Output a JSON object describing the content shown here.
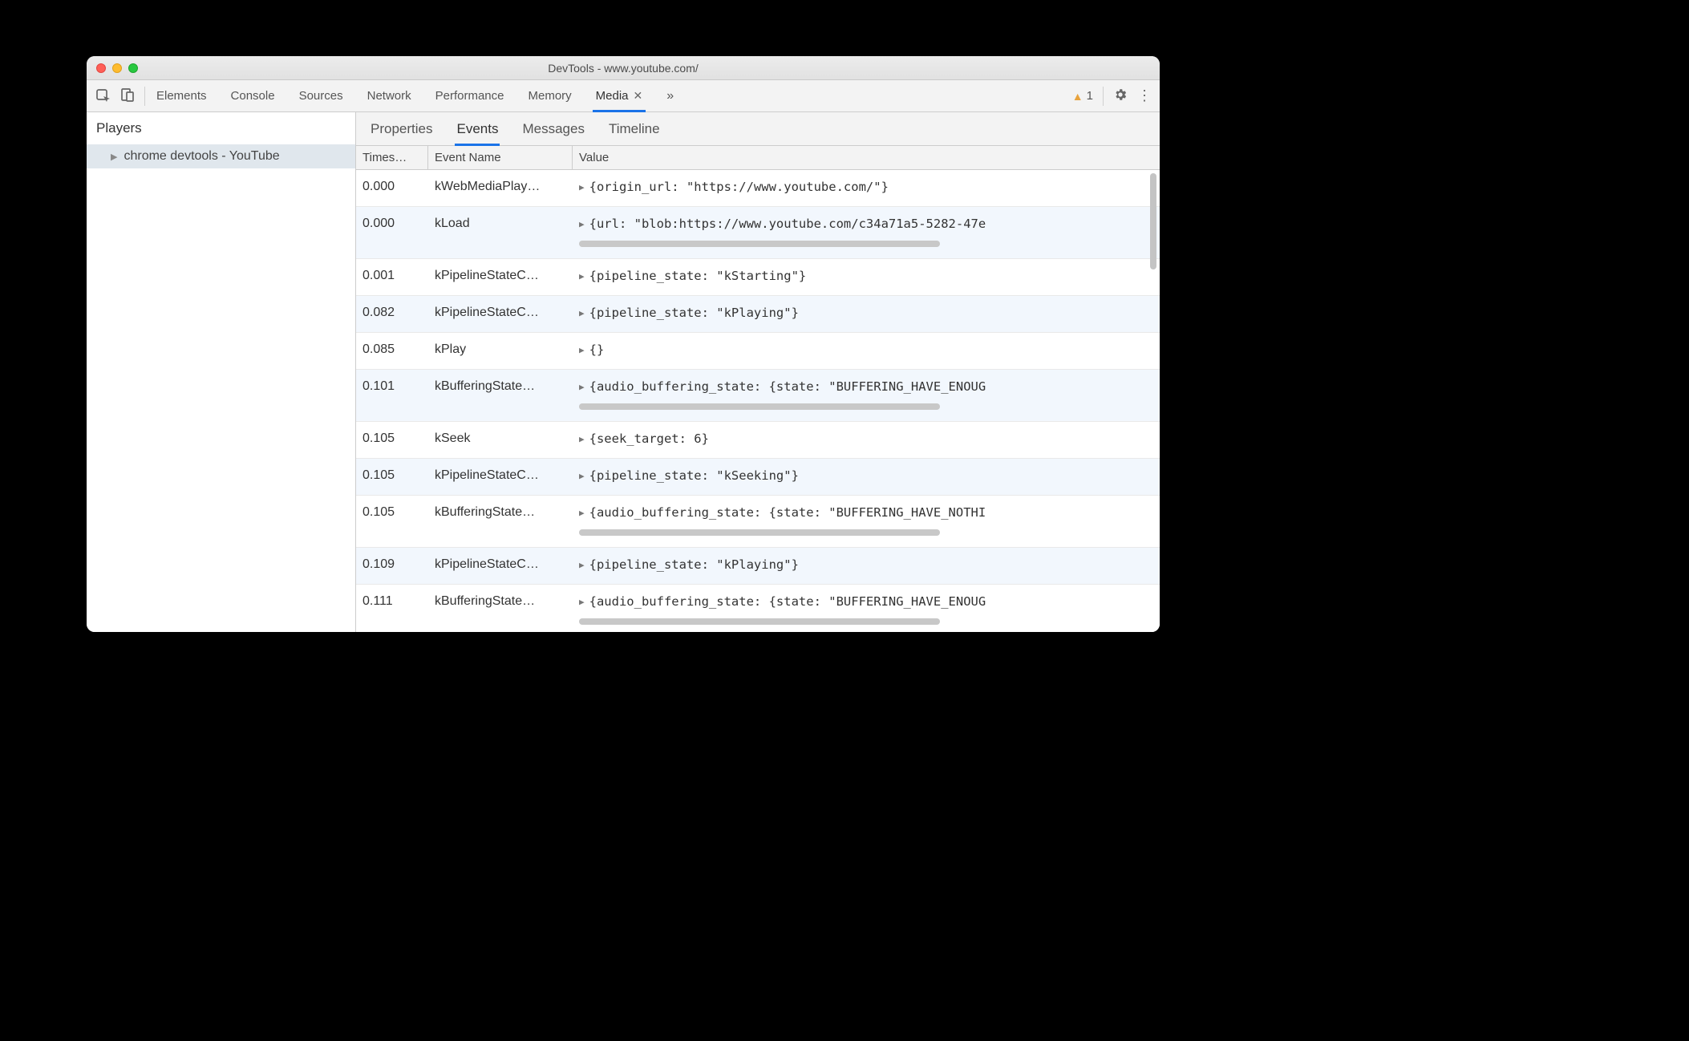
{
  "window": {
    "title_prefix": "DevTools - ",
    "title_url": "www.youtube.com/"
  },
  "toolbar": {
    "tabs": [
      "Elements",
      "Console",
      "Sources",
      "Network",
      "Performance",
      "Memory",
      "Media"
    ],
    "active_tab": "Media",
    "warning_count": "1"
  },
  "sidebar": {
    "header": "Players",
    "items": [
      "chrome devtools - YouTube"
    ]
  },
  "subtabs": {
    "items": [
      "Properties",
      "Events",
      "Messages",
      "Timeline"
    ],
    "active": "Events"
  },
  "table": {
    "headers": {
      "time": "Times…",
      "event": "Event Name",
      "value": "Value"
    },
    "rows": [
      {
        "time": "0.000",
        "event": "kWebMediaPlay…",
        "value": "{origin_url: \"https://www.youtube.com/\"}",
        "overflow": false
      },
      {
        "time": "0.000",
        "event": "kLoad",
        "value": "{url: \"blob:https://www.youtube.com/c34a71a5-5282-47e",
        "overflow": true
      },
      {
        "time": "0.001",
        "event": "kPipelineStateC…",
        "value": "{pipeline_state: \"kStarting\"}",
        "overflow": false
      },
      {
        "time": "0.082",
        "event": "kPipelineStateC…",
        "value": "{pipeline_state: \"kPlaying\"}",
        "overflow": false
      },
      {
        "time": "0.085",
        "event": "kPlay",
        "value": "{}",
        "overflow": false
      },
      {
        "time": "0.101",
        "event": "kBufferingState…",
        "value": "{audio_buffering_state: {state: \"BUFFERING_HAVE_ENOUG",
        "overflow": true
      },
      {
        "time": "0.105",
        "event": "kSeek",
        "value": "{seek_target: 6}",
        "overflow": false
      },
      {
        "time": "0.105",
        "event": "kPipelineStateC…",
        "value": "{pipeline_state: \"kSeeking\"}",
        "overflow": false
      },
      {
        "time": "0.105",
        "event": "kBufferingState…",
        "value": "{audio_buffering_state: {state: \"BUFFERING_HAVE_NOTHI",
        "overflow": true
      },
      {
        "time": "0.109",
        "event": "kPipelineStateC…",
        "value": "{pipeline_state: \"kPlaying\"}",
        "overflow": false
      },
      {
        "time": "0.111",
        "event": "kBufferingState…",
        "value": "{audio_buffering_state: {state: \"BUFFERING_HAVE_ENOUG",
        "overflow": true
      }
    ]
  }
}
